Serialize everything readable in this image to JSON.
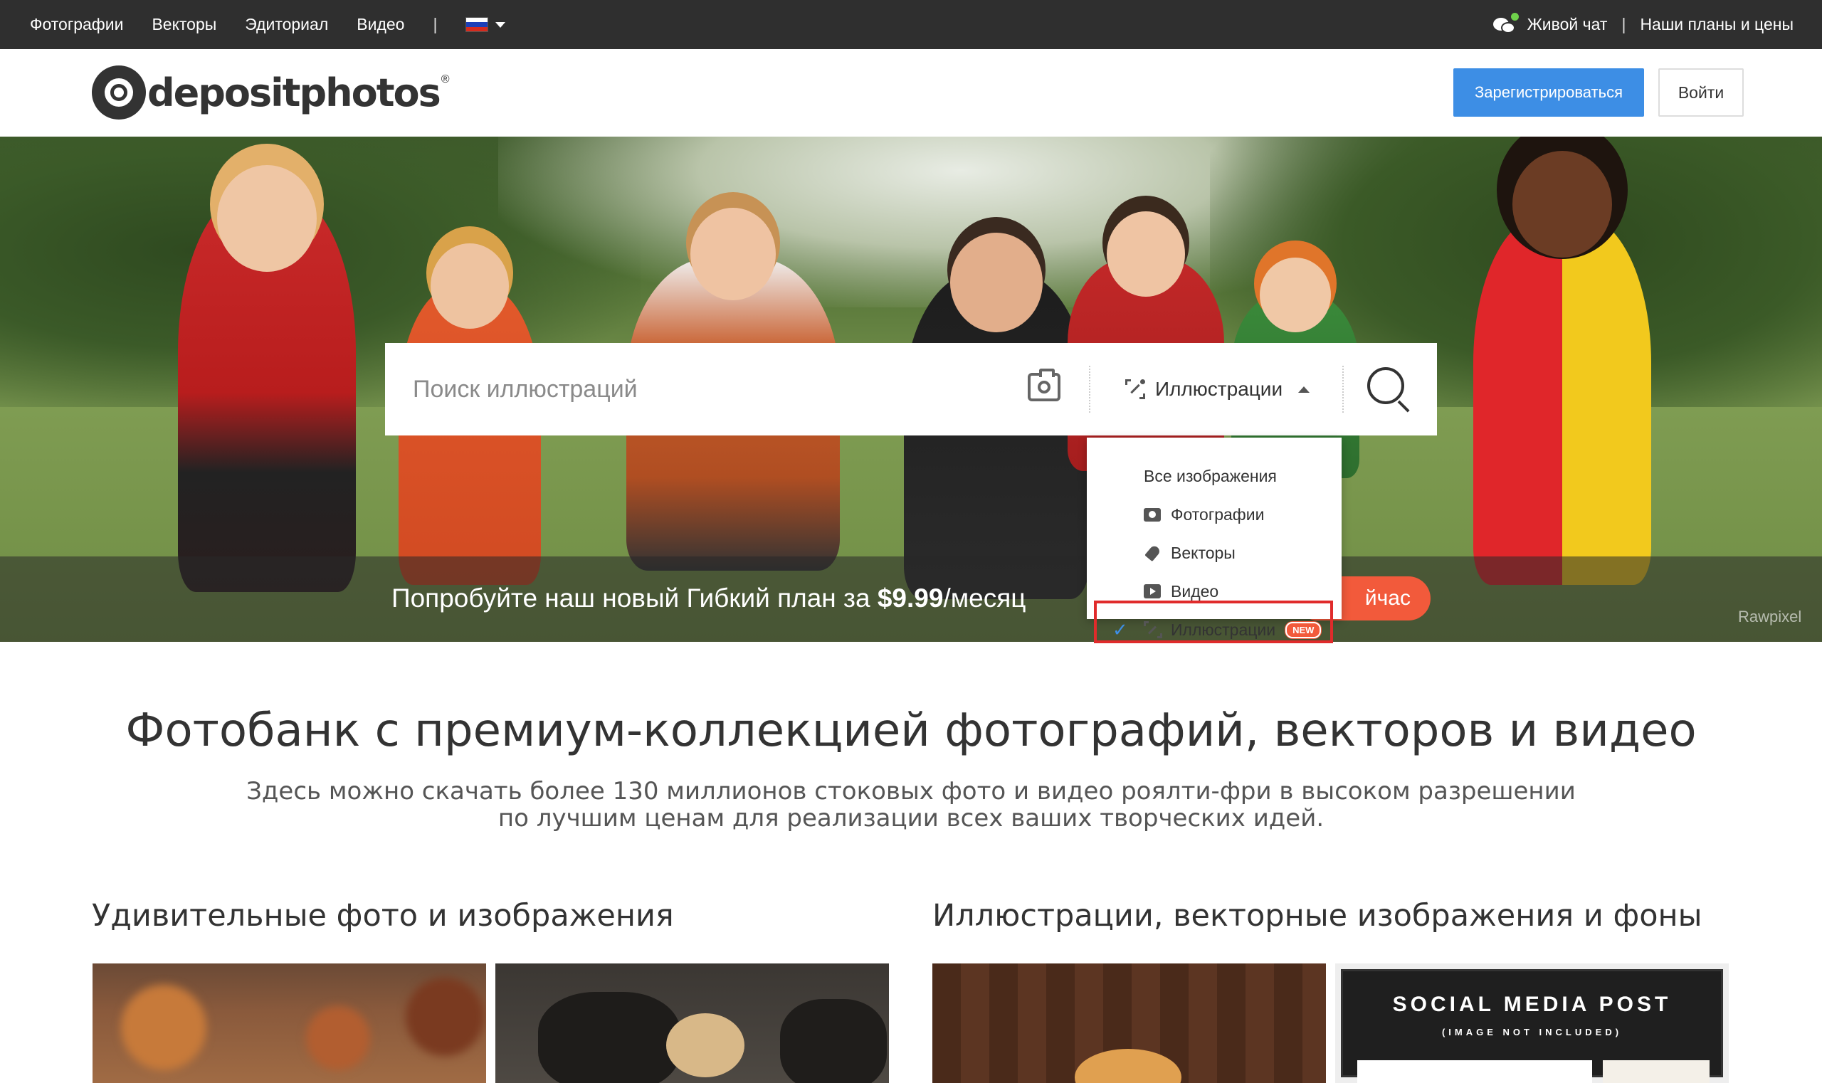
{
  "topnav": {
    "items": [
      "Фотографии",
      "Векторы",
      "Эдиториал",
      "Видео"
    ],
    "separator": "|",
    "live_chat": "Живой чат",
    "right_sep": "|",
    "plans": "Наши планы и цены"
  },
  "header": {
    "logo_text": "depositphotos",
    "logo_mark": "®",
    "register": "Зарегистрироваться",
    "login": "Войти"
  },
  "search": {
    "placeholder": "Поиск иллюстраций",
    "type_label": "Иллюстрации"
  },
  "dropdown": {
    "items": [
      "Все изображения",
      "Фотографии",
      "Векторы",
      "Видео",
      "Иллюстрации"
    ],
    "new_badge": "NEW",
    "selected": "Иллюстрации"
  },
  "promo": {
    "text_pre": "Попробуйте наш новый Гибкий план за ",
    "price": "$9.99",
    "text_post": "/месяц",
    "button": "йчас",
    "credit": "Rawpixel"
  },
  "main": {
    "title": "Фотобанк с премиум-коллекцией фотографий, векторов и видео",
    "subtitle_1": "Здесь можно скачать более 130 миллионов стоковых фото и видео роялти-фри в высоком разрешении",
    "subtitle_2": "по лучшим ценам для реализации всех ваших творческих идей.",
    "section_left": "Удивительные фото и изображения",
    "section_right": "Иллюстрации, векторные изображения и фоны",
    "thumb_social_title": "SOCIAL MEDIA POST",
    "thumb_social_sub": "(IMAGE NOT INCLUDED)"
  },
  "colors": {
    "topbar": "#2f2f2f",
    "register_btn": "#3d8ee5",
    "promo_btn": "#f25a3b",
    "highlight_border": "#e02b2b"
  },
  "icons": [
    "chat-icon",
    "camera-search-icon",
    "illustration-icon",
    "search-icon",
    "photo-icon",
    "vector-icon",
    "video-icon",
    "check-icon"
  ]
}
